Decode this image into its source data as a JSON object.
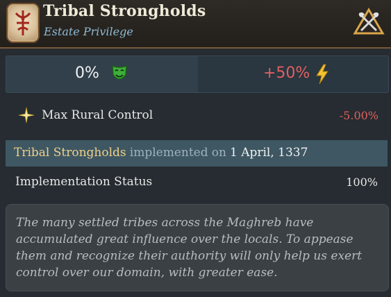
{
  "header": {
    "title": "Tribal Strongholds",
    "subtitle": "Estate Privilege",
    "emblem_icon": "tribal-glyph-icon",
    "estate_icon": "axes-estate-icon"
  },
  "stats": {
    "satisfaction_value": "0%",
    "satisfaction_icon": "green-mask-icon",
    "influence_value": "+50%",
    "influence_icon": "lightning-bolt-icon"
  },
  "modifier": {
    "icon": "star-burst-icon",
    "label": "Max Rural Control",
    "value": "-5.00%"
  },
  "implementation": {
    "name": "Tribal Strongholds",
    "connector1": "implemented",
    "connector2": "on",
    "date": "1 April, 1337"
  },
  "status": {
    "label": "Implementation Status",
    "value": "100%"
  },
  "description": "The many settled tribes across the Maghreb have accumulated great influence over the locals. To appease them and recognize their authority will only help us exert control over our domain, with greater ease.",
  "colors": {
    "negative": "#e06060",
    "highlight": "#f0d08a",
    "subtitle": "#8fb9d4"
  }
}
